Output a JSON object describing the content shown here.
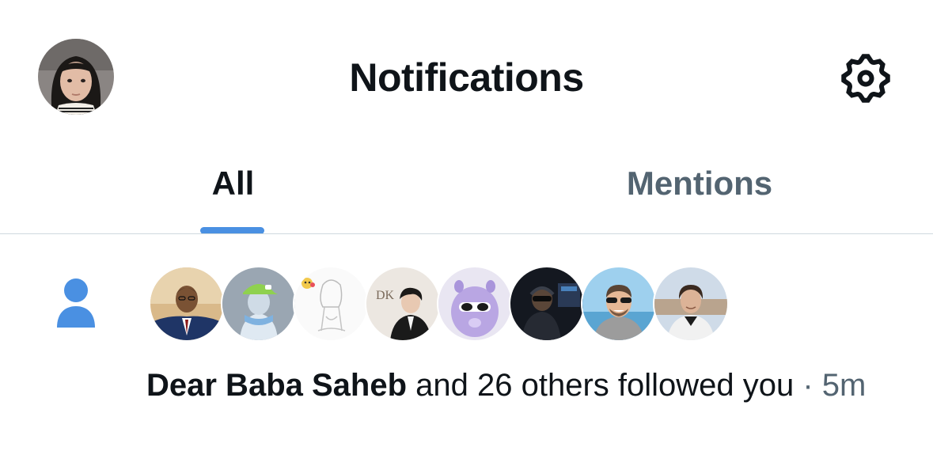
{
  "header": {
    "title": "Notifications",
    "avatar_icon": "user-avatar",
    "settings_icon": "gear-icon"
  },
  "tabs": [
    {
      "label": "All",
      "active": true
    },
    {
      "label": "Mentions",
      "active": false
    }
  ],
  "colors": {
    "accent": "#1d9bf0",
    "indicator": "#4a90e2",
    "primary_text": "#0f1419",
    "secondary_text": "#536471",
    "divider": "#cfd9de"
  },
  "notification": {
    "type_icon": "person-icon",
    "follower_count_avatars": 8,
    "name": "Dear Baba Saheb",
    "action": " and 26 others followed you",
    "separator": " · ",
    "time": "5m"
  }
}
